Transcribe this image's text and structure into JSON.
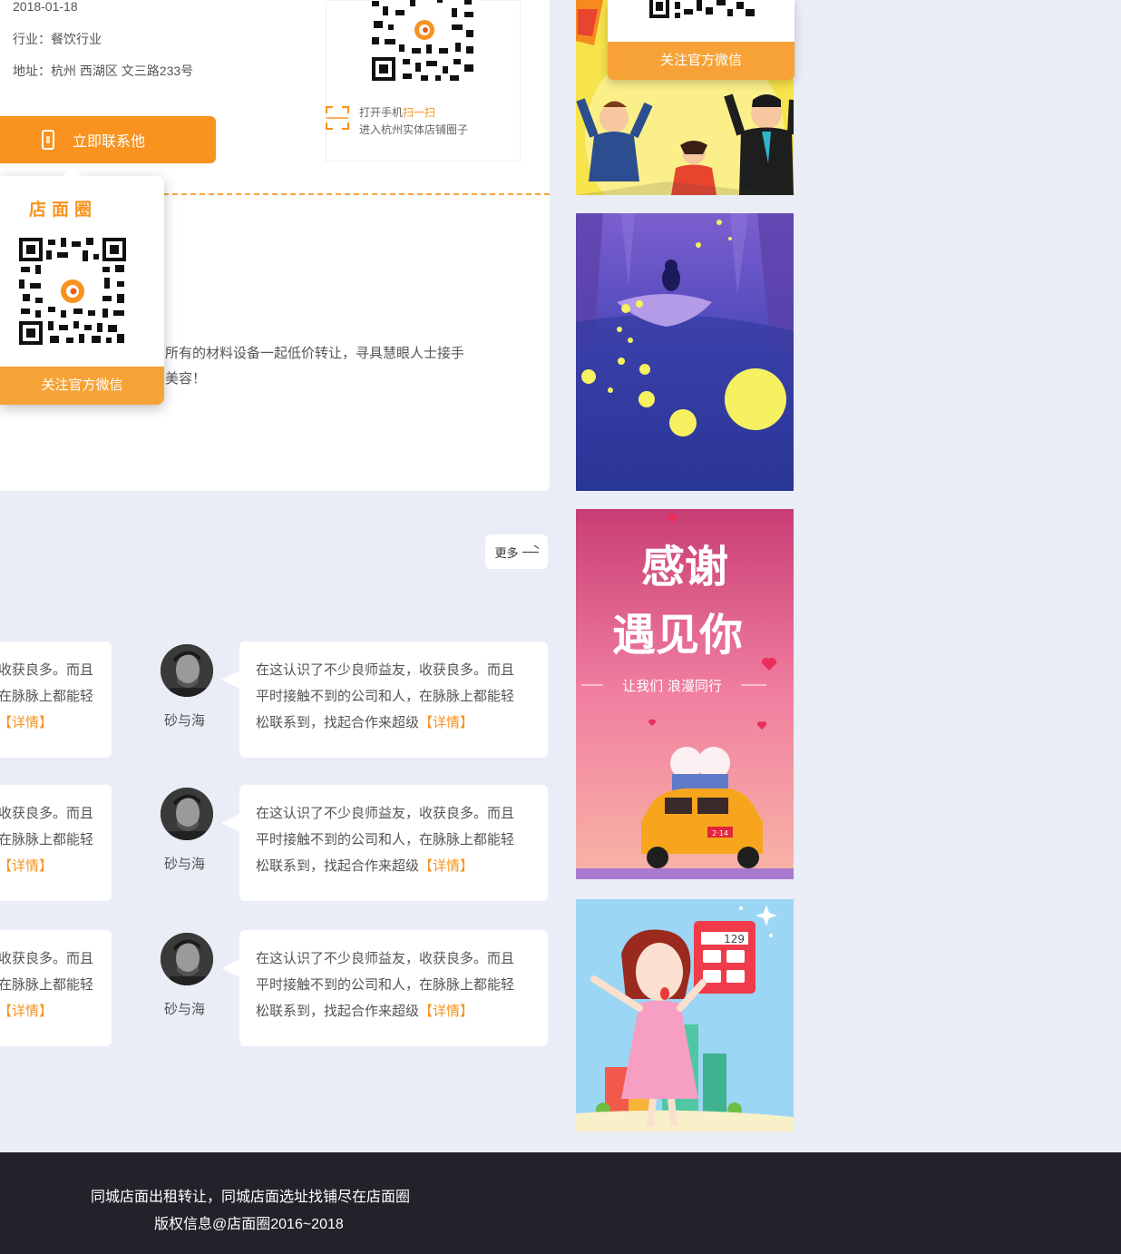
{
  "company": {
    "date": "2018-01-18",
    "industry": "行业：餐饮行业",
    "address": "地址：杭州 西湖区 文三路233号",
    "contact_button": "立即联系他",
    "description_line1": "所有的材料设备一起低价转让，寻具慧眼人士接手",
    "description_line2": "美容！"
  },
  "qr_scan": {
    "line1_prefix": "打开手机",
    "line1_highlight": "扫一扫",
    "line2": "进入杭州实体店铺圈子"
  },
  "popup": {
    "brand": "店面圈",
    "follow_label": "关注官方微信"
  },
  "sidebar_wechat": {
    "follow_label": "关注官方微信"
  },
  "comments_section": {
    "more_label": "更多"
  },
  "comments": [
    {
      "left_l1": "收获良多。而且",
      "left_l2": "在脉脉上都能轻",
      "left_detail": "【详情】",
      "username": "砂与海",
      "l1": "在这认识了不少良师益友，收获良多。而且",
      "l2": "平时接触不到的公司和人，在脉脉上都能轻",
      "l3": "松联系到，找起合作来超级",
      "detail": "【详情】"
    },
    {
      "left_l1": "收获良多。而且",
      "left_l2": "在脉脉上都能轻",
      "left_detail": "【详情】",
      "username": "砂与海",
      "l1": "在这认识了不少良师益友，收获良多。而且",
      "l2": "平时接触不到的公司和人，在脉脉上都能轻",
      "l3": "松联系到，找起合作来超级",
      "detail": "【详情】"
    },
    {
      "left_l1": "收获良多。而且",
      "left_l2": "在脉脉上都能轻",
      "left_detail": "【详情】",
      "username": "砂与海",
      "l1": "在这认识了不少良师益友，收获良多。而且",
      "l2": "平时接触不到的公司和人，在脉脉上都能轻",
      "l3": "松联系到，找起合作来超级",
      "detail": "【详情】"
    }
  ],
  "ads": {
    "thanks_title": "感谢遇见你",
    "thanks_sub": "让我们 浪漫同行",
    "plate": "2·14",
    "calc_value": "129"
  },
  "footer": {
    "line1": "同城店面出租转让，同城店面选址找铺尽在店面圈",
    "line2": "版权信息@店面圈2016~2018"
  },
  "colors": {
    "accent": "#f7931e",
    "background": "#e9edf5",
    "footer_bg": "#23222b"
  }
}
